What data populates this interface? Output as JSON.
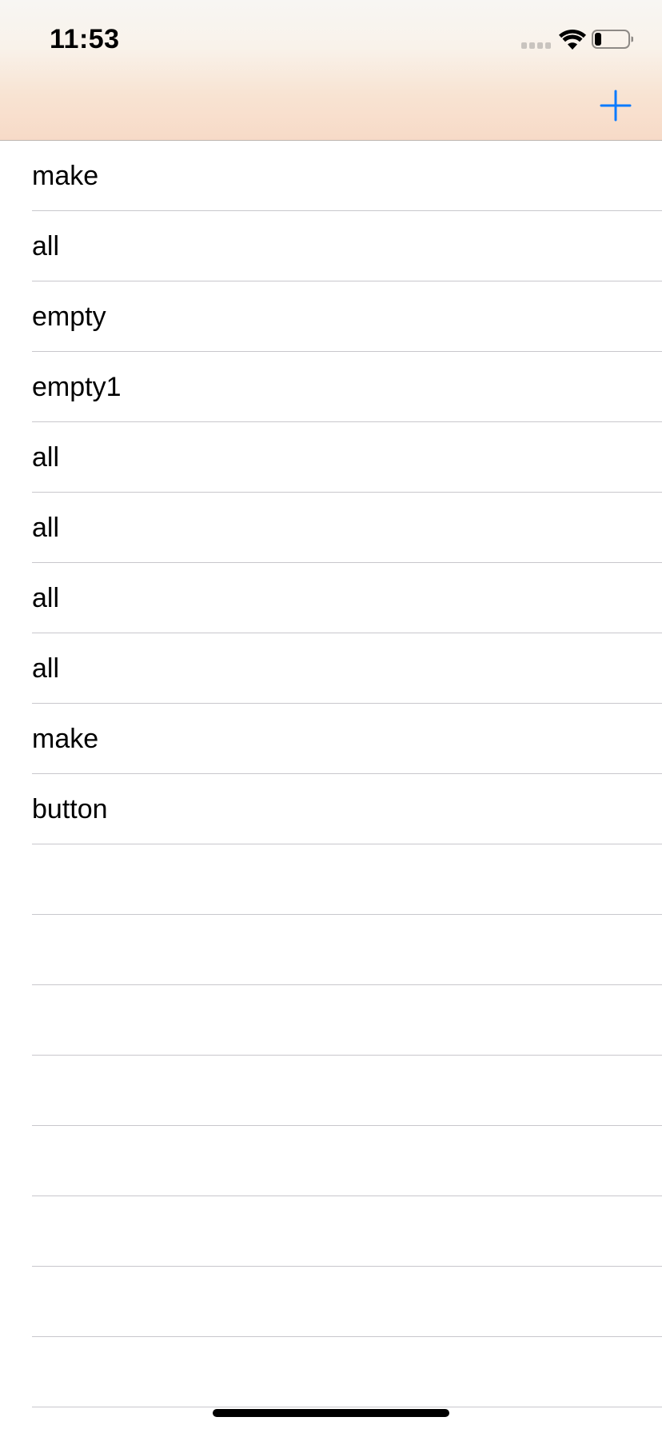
{
  "status_bar": {
    "time": "11:53",
    "signal_icon": "signal-bars-icon",
    "wifi_icon": "wifi-icon",
    "battery_icon": "battery-icon",
    "battery_level": 0.2
  },
  "nav_bar": {
    "add_icon": "plus-icon",
    "accent_color": "#0a7aff"
  },
  "list": {
    "rows": [
      {
        "label": "make"
      },
      {
        "label": "all"
      },
      {
        "label": "empty"
      },
      {
        "label": "empty1"
      },
      {
        "label": "all"
      },
      {
        "label": "all"
      },
      {
        "label": "all"
      },
      {
        "label": "all"
      },
      {
        "label": "make"
      },
      {
        "label": "button"
      },
      {
        "label": ""
      },
      {
        "label": ""
      },
      {
        "label": ""
      },
      {
        "label": ""
      },
      {
        "label": ""
      },
      {
        "label": ""
      },
      {
        "label": ""
      },
      {
        "label": ""
      }
    ]
  }
}
